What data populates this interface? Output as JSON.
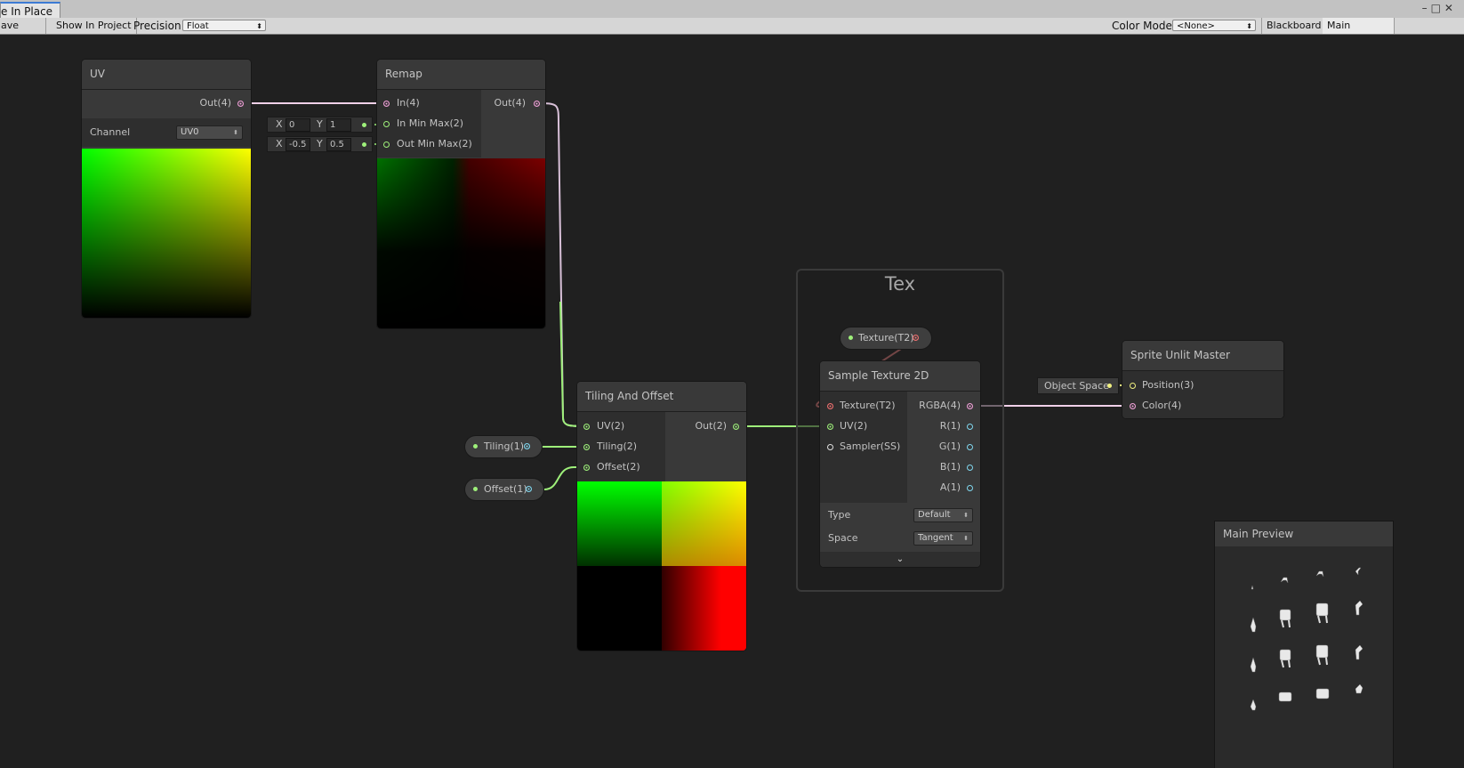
{
  "window": {
    "tab_title": "e In Place",
    "controls": "–□✕"
  },
  "toolbar": {
    "save_asset": "ave Asset",
    "show_in_project": "Show In Project",
    "precision_label": "Precision",
    "precision_value": "Float",
    "color_mode_label": "Color Mode",
    "color_mode_value": "<None>",
    "blackboard": "Blackboard",
    "main_preview": "Main Preview"
  },
  "nodes": {
    "uv": {
      "title": "UV",
      "out": "Out(4)",
      "channel_label": "Channel",
      "channel_value": "UV0"
    },
    "remap": {
      "title": "Remap",
      "in": "In(4)",
      "out": "Out(4)",
      "in_min_max": "In Min Max(2)",
      "out_min_max": "Out Min Max(2)",
      "in_x_label": "X",
      "in_x": "0",
      "in_y_label": "Y",
      "in_y": "1",
      "out_x_label": "X",
      "out_x": "-0.5",
      "out_y_label": "Y",
      "out_y": "0.5"
    },
    "tiling": {
      "title": "Tiling And Offset",
      "uv": "UV(2)",
      "tiling": "Tiling(2)",
      "offset": "Offset(2)",
      "out": "Out(2)"
    },
    "tiling_prop": {
      "label": "Tiling(1)"
    },
    "offset_prop": {
      "label": "Offset(1)"
    },
    "group": {
      "title": "Tex"
    },
    "texture_prop": {
      "label": "Texture(T2)"
    },
    "sample": {
      "title": "Sample Texture 2D",
      "texture": "Texture(T2)",
      "uv": "UV(2)",
      "sampler": "Sampler(SS)",
      "rgba": "RGBA(4)",
      "r": "R(1)",
      "g": "G(1)",
      "b": "B(1)",
      "a": "A(1)",
      "type_label": "Type",
      "type_value": "Default",
      "space_label": "Space",
      "space_value": "Tangent"
    },
    "master": {
      "title": "Sprite Unlit Master",
      "position": "Position(3)",
      "color": "Color(4)",
      "object_space": "Object Space"
    }
  },
  "preview": {
    "title": "Main Preview"
  },
  "colors": {
    "vec4": "#f0a0d8",
    "vec2": "#9ef07a",
    "vec1": "#80d8f0",
    "tex": "#f07070",
    "vec3": "#f0f080"
  }
}
